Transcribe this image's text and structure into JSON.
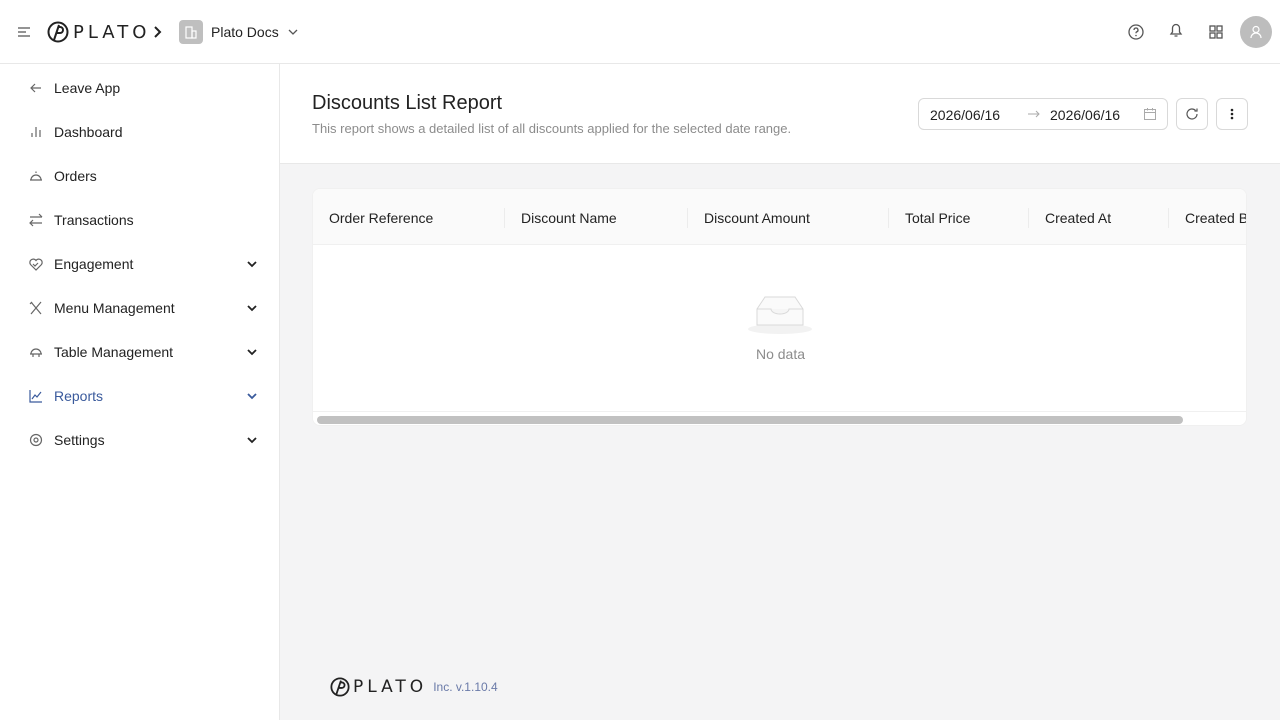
{
  "header": {
    "brand": "PLATO",
    "org_name": "Plato Docs",
    "icons": [
      "menu-icon",
      "help-icon",
      "bell-icon",
      "apps-icon",
      "user-icon"
    ]
  },
  "sidebar": {
    "items": [
      {
        "label": "Leave App",
        "icon": "arrow-left-icon",
        "expandable": false
      },
      {
        "label": "Dashboard",
        "icon": "bar-chart-icon",
        "expandable": false
      },
      {
        "label": "Orders",
        "icon": "cloche-icon",
        "expandable": false
      },
      {
        "label": "Transactions",
        "icon": "swap-icon",
        "expandable": false
      },
      {
        "label": "Engagement",
        "icon": "heart-handshake-icon",
        "expandable": true
      },
      {
        "label": "Menu Management",
        "icon": "utensils-icon",
        "expandable": true
      },
      {
        "label": "Table Management",
        "icon": "table-bell-icon",
        "expandable": true
      },
      {
        "label": "Reports",
        "icon": "line-chart-icon",
        "expandable": true,
        "active": true
      },
      {
        "label": "Settings",
        "icon": "gear-icon",
        "expandable": true
      }
    ]
  },
  "page": {
    "title": "Discounts List Report",
    "description": "This report shows a detailed list of all discounts applied for the selected date range.",
    "date_start": "2026/06/16",
    "date_end": "2026/06/16"
  },
  "table": {
    "columns": [
      "Order Reference",
      "Discount Name",
      "Discount Amount",
      "Total Price",
      "Created At",
      "Created By"
    ],
    "rows": [],
    "empty_text": "No data"
  },
  "footer": {
    "brand": "PLATO",
    "version": "Inc. v.1.10.4"
  },
  "colors": {
    "accent": "#3a5a9c",
    "background": "#f4f4f5",
    "border": "#e8e8e8"
  }
}
